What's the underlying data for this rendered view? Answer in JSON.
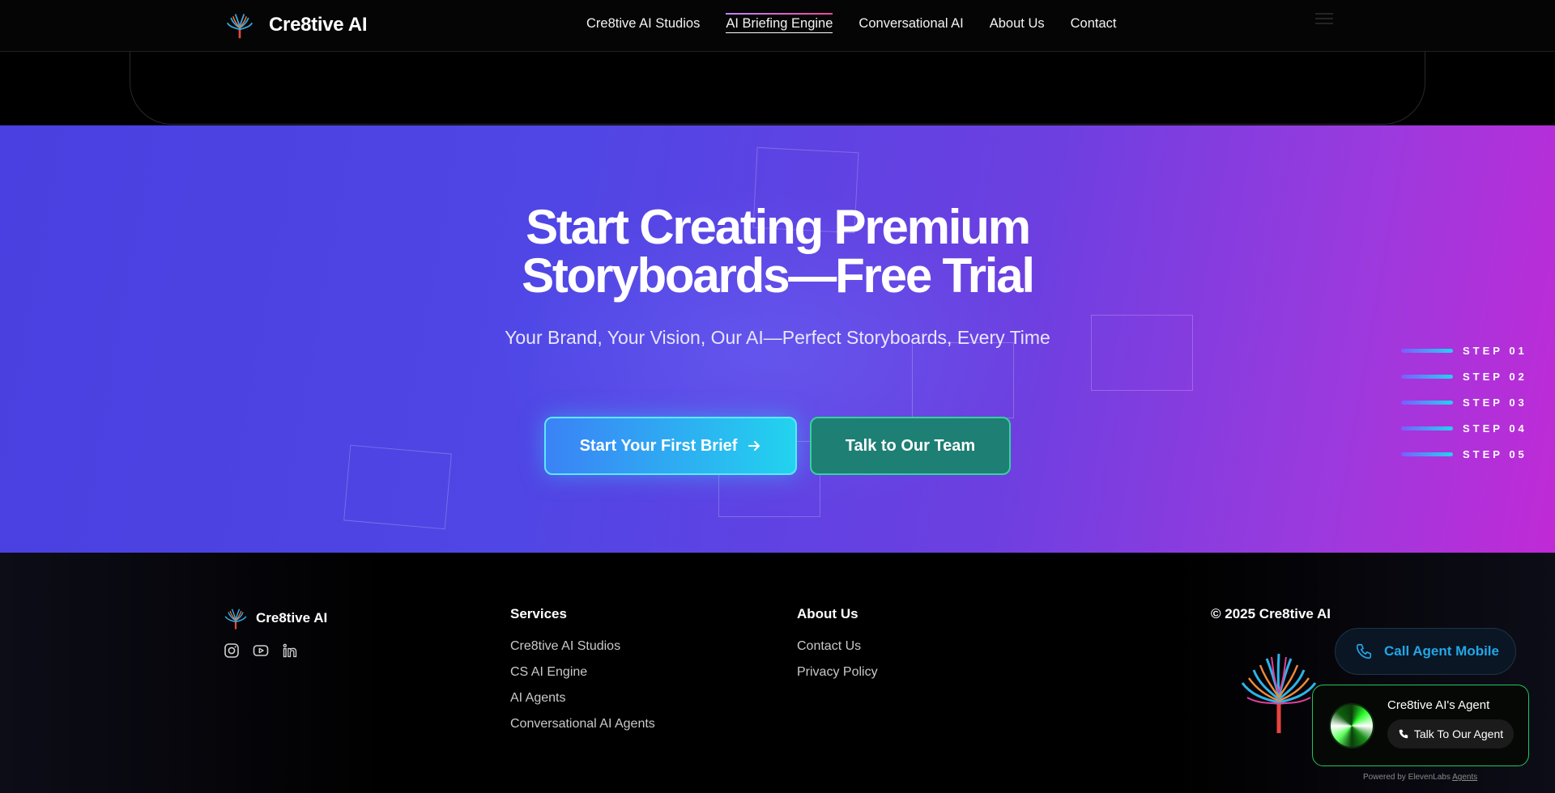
{
  "nav": {
    "brand": "Cre8tive AI",
    "links": [
      "Cre8tive AI Studios",
      "AI Briefing Engine",
      "Conversational AI",
      "About Us",
      "Contact"
    ],
    "active_link": "AI Briefing Engine"
  },
  "hero": {
    "title_line1": "Start Creating Premium",
    "title_line2": "Storyboards—Free Trial",
    "subtitle": "Your Brand, Your Vision, Our AI—Perfect Storyboards, Every Time",
    "primary_cta": "Start Your First Brief",
    "secondary_cta": "Talk to Our Team",
    "steps": [
      "STEP 01",
      "STEP 02",
      "STEP 03",
      "STEP 04",
      "STEP 05"
    ]
  },
  "footer": {
    "brand": "Cre8tive AI",
    "socials": [
      "instagram-icon",
      "youtube-icon",
      "linkedin-icon"
    ],
    "services_heading": "Services",
    "services": [
      "Cre8tive AI Studios",
      "CS AI Engine",
      "AI Agents",
      "Conversational AI Agents"
    ],
    "about_heading": "About Us",
    "about_links": [
      "Contact Us",
      "Privacy Policy"
    ],
    "copyright": "© 2025 Cre8tive AI"
  },
  "widget": {
    "call_mobile": "Call Agent Mobile",
    "agent_name": "Cre8tive AI's Agent",
    "agent_button": "Talk To Our Agent",
    "powered_prefix": "Powered by ElevenLabs",
    "powered_link": "Agents"
  },
  "colors": {
    "accent_cyan": "#22d3ee",
    "accent_green": "#34d399",
    "hero_start": "#4a3fe0",
    "hero_end": "#c02ad6"
  }
}
